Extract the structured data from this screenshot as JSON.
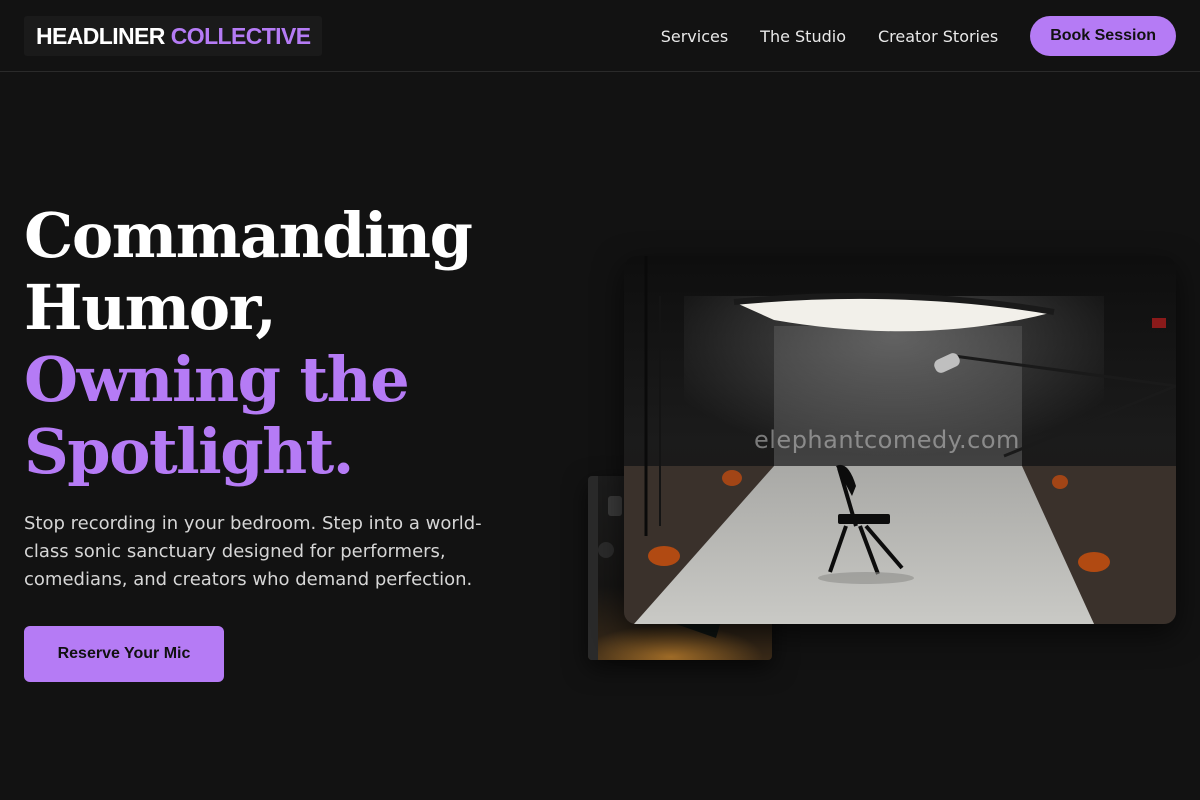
{
  "brand": {
    "name_part1": "HEADLINER",
    "name_part2": "COLLECTIVE"
  },
  "nav": {
    "links": [
      "Services",
      "The Studio",
      "Creator Stories"
    ],
    "cta_label": "Book Session"
  },
  "hero": {
    "title_lines": [
      "Commanding",
      "Humor,",
      "Owning the",
      "Spotlight."
    ],
    "subtitle": "Stop recording in your bedroom. Step into a world-class sonic sanctuary designed for performers, comedians, and creators who demand perfection.",
    "cta_label": "Reserve Your Mic"
  },
  "media": {
    "main_image": "studio-chair-photo",
    "secondary_image": "studio-equipment-photo",
    "watermark": "elephantcomedy.com"
  },
  "colors": {
    "background": "#121212",
    "accent": "#b57bf5",
    "text": "#ffffff"
  }
}
